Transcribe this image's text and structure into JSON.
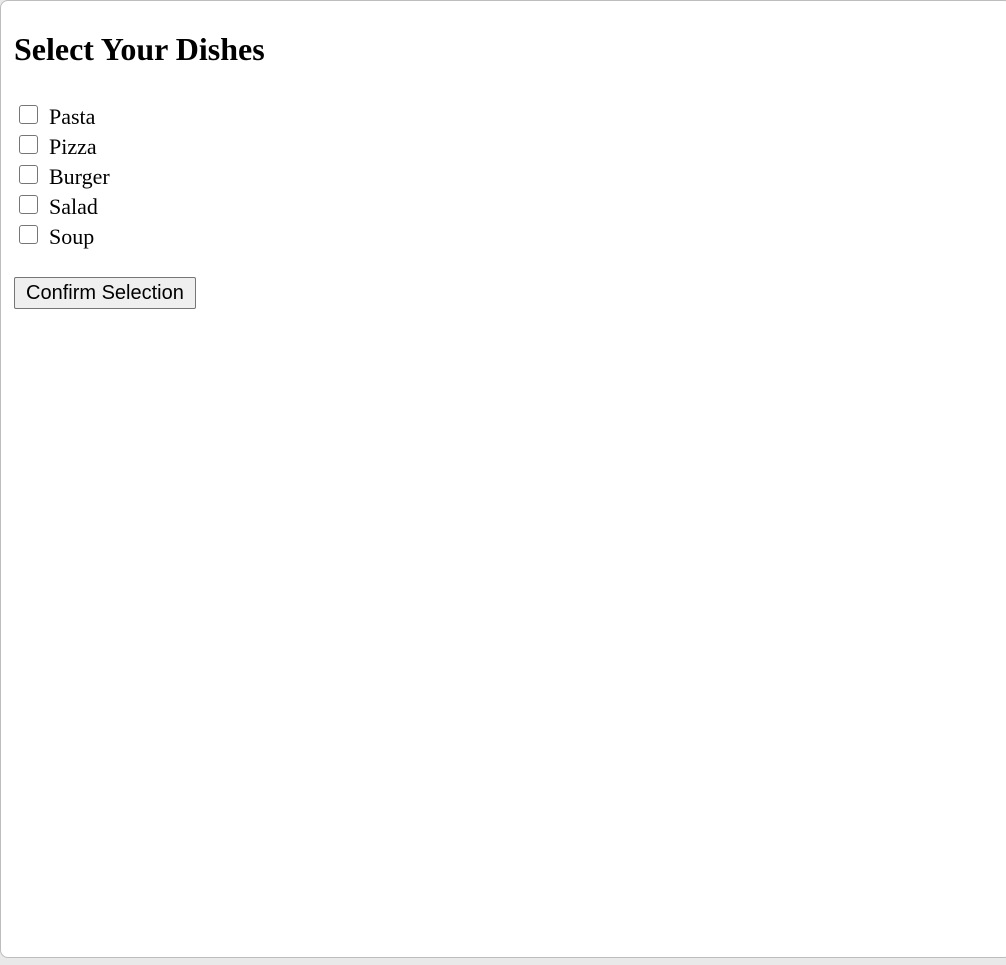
{
  "page": {
    "title": "Select Your Dishes"
  },
  "dishes": [
    {
      "label": "Pasta",
      "checked": false
    },
    {
      "label": "Pizza",
      "checked": false
    },
    {
      "label": "Burger",
      "checked": false
    },
    {
      "label": "Salad",
      "checked": false
    },
    {
      "label": "Soup",
      "checked": false
    }
  ],
  "actions": {
    "confirm_label": "Confirm Selection"
  }
}
